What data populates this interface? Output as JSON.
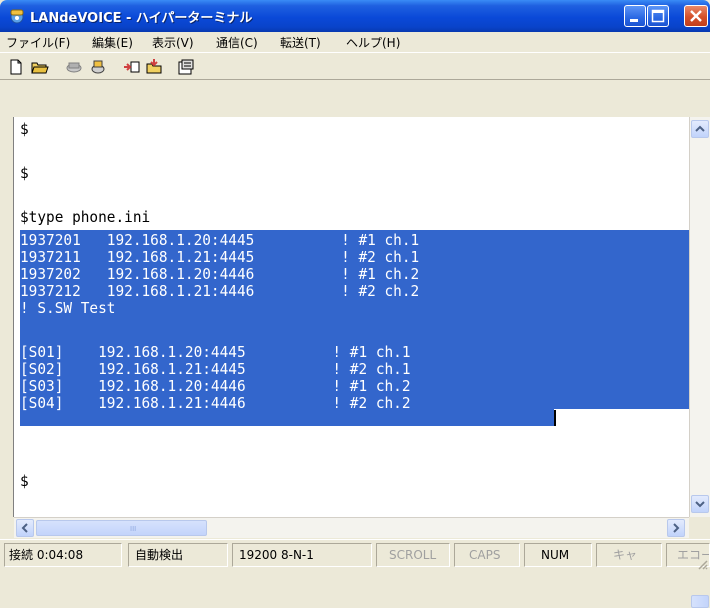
{
  "window": {
    "title": "LANdeVOICE - ハイパーターミナル",
    "app_icon": "phone-icon",
    "controls": [
      "minimize-icon",
      "maximize-icon",
      "close-icon"
    ],
    "colors": {
      "titlebar": "#0a49d8",
      "selection": "#3366cc",
      "terminal_bg": "#ffffff"
    }
  },
  "menu": {
    "items": [
      "ファイル(F)",
      "編集(E)",
      "表示(V)",
      "通信(C)",
      "転送(T)",
      "ヘルプ(H)"
    ]
  },
  "toolbar": {
    "icons": [
      "new-document-icon",
      "open-folder-icon",
      "connect-icon",
      "disconnect-icon",
      "send-file-icon",
      "receive-file-icon",
      "properties-icon"
    ]
  },
  "terminal": {
    "lines": [
      "$",
      "$",
      "$type phone.ini",
      "1937201   192.168.1.20:4445          ! #1 ch.1",
      "1937211   192.168.1.21:4445          ! #2 ch.1",
      "1937202   192.168.1.20:4446          ! #1 ch.2",
      "1937212   192.168.1.21:4446          ! #2 ch.2",
      "! S.SW Test",
      "[S01]    192.168.1.20:4445          ! #1 ch.1",
      "[S02]    192.168.1.21:4445          ! #2 ch.1",
      "[S03]    192.168.1.20:4446          ! #1 ch.2",
      "[S04]    192.168.1.21:4446          ! #2 ch.2",
      "$"
    ]
  },
  "scrollbars": {
    "horizontal_grip": "III",
    "icons": [
      "scroll-up-icon",
      "scroll-down-icon",
      "scroll-left-icon",
      "scroll-right-icon"
    ]
  },
  "status": {
    "connected_time": "接続 0:04:08",
    "detect": "自動検出",
    "settings": "19200 8-N-1",
    "scroll": "SCROLL",
    "caps": "CAPS",
    "num": "NUM",
    "capture": "キャ",
    "echo": "エコー"
  }
}
